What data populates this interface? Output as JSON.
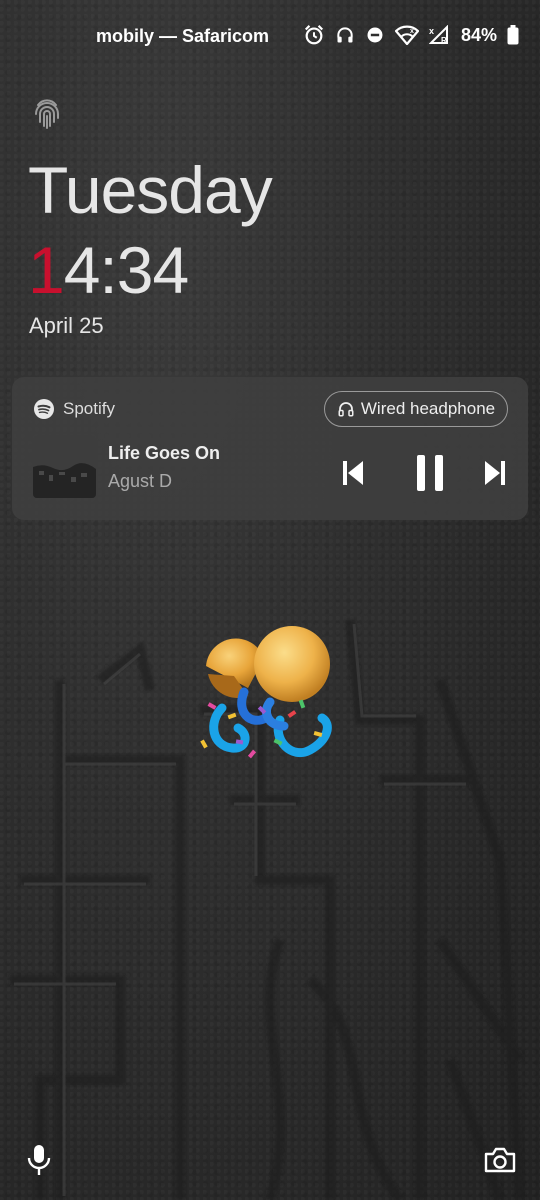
{
  "status_bar": {
    "carrier": "mobily — Safaricom",
    "battery": "84%",
    "icons": [
      "alarm-icon",
      "headphones-icon",
      "do-not-disturb-icon",
      "wifi-icon",
      "signal-roaming-icon",
      "battery-icon"
    ]
  },
  "lock": {
    "day": "Tuesday",
    "time_first": "1",
    "time_rest": "4:34",
    "date": "April 25",
    "accent_color": "#c8102e"
  },
  "media": {
    "app_name": "Spotify",
    "output_device": "Wired headphone",
    "track_title": "Life Goes On",
    "track_artist": "Agust D",
    "controls": [
      "previous-icon",
      "pause-icon",
      "next-icon"
    ]
  },
  "shortcuts": {
    "left": "microphone-icon",
    "right": "camera-icon"
  }
}
